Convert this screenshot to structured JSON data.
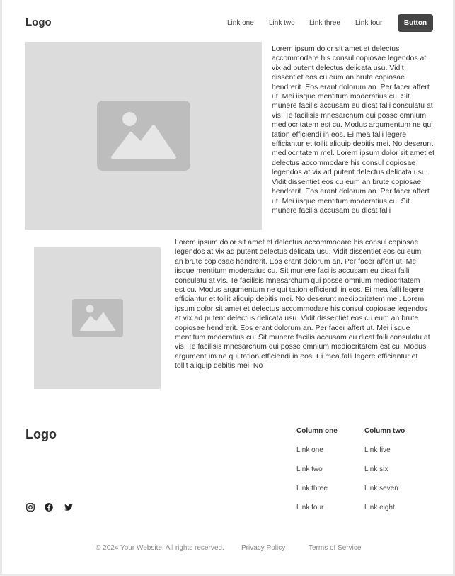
{
  "header": {
    "logo": "Logo",
    "links": [
      "Link one",
      "Link two",
      "Link three",
      "Link four"
    ],
    "button_label": "Button"
  },
  "section_one": {
    "image_icon": "image-placeholder-icon",
    "text": "Lorem ipsum dolor sit amet et delectus accommodare his consul copiosae legendos at vix ad putent delectus delicata usu. Vidit dissentiet eos cu eum an brute copiosae hendrerit. Eos erant dolorum an. Per facer affert ut. Mei iisque mentitum moderatius cu. Sit munere facilis accusam eu dicat falli consulatu at vis. Te facilisis mnesarchum qui posse omnium mediocritatem est cu. Modus argumentum ne qui tation efficiendi in eos. Ei mea falli legere efficiantur et tollit aliquip debitis mei. No deserunt mediocritatem mel. Lorem ipsum dolor sit amet et delectus accommodare his consul copiosae legendos at vix ad putent delectus delicata usu. Vidit dissentiet eos cu eum an brute copiosae hendrerit. Eos erant dolorum an. Per facer affert ut. Mei iisque mentitum moderatius cu. Sit munere facilis accusam eu dicat falli"
  },
  "section_two": {
    "image_icon": "image-placeholder-icon",
    "text": "Lorem ipsum dolor sit amet et delectus accommodare his consul copiosae legendos at vix ad putent delectus delicata usu. Vidit dissentiet eos cu eum an brute copiosae hendrerit. Eos erant dolorum an. Per facer affert ut. Mei iisque mentitum moderatius cu. Sit munere facilis accusam eu dicat falli consulatu at vis. Te facilisis mnesarchum qui posse omnium mediocritatem est cu. Modus argumentum ne qui tation efficiendi in eos. Ei mea falli legere efficiantur et tollit aliquip debitis mei. No deserunt mediocritatem mel. Lorem ipsum dolor sit amet et delectus accommodare his consul copiosae legendos at vix ad putent delectus delicata usu. Vidit dissentiet eos cu eum an brute copiosae hendrerit. Eos erant dolorum an. Per facer affert ut. Mei iisque mentitum moderatius cu. Sit munere facilis accusam eu dicat falli consulatu at vis. Te facilisis mnesarchum qui posse omnium mediocritatem est cu. Modus argumentum ne qui tation efficiendi in eos. Ei mea falli legere efficiantur et tollit aliquip debitis mei. No"
  },
  "footer": {
    "logo": "Logo",
    "social_icons": [
      "instagram-icon",
      "facebook-icon",
      "twitter-icon"
    ],
    "column_one": {
      "title": "Column one",
      "links": [
        "Link one",
        "Link two",
        "Link three",
        "Link four"
      ]
    },
    "column_two": {
      "title": "Column two",
      "links": [
        "Link five",
        "Link six",
        "Link seven",
        "Link eight"
      ]
    },
    "copyright": "© 2024 Your Website. All rights reserved.",
    "privacy": "Privacy Policy",
    "terms": "Terms of Service"
  },
  "colors": {
    "button_bg": "#444444",
    "placeholder_bg": "#dcdcdc",
    "placeholder_icon": "#bdbdbd"
  }
}
